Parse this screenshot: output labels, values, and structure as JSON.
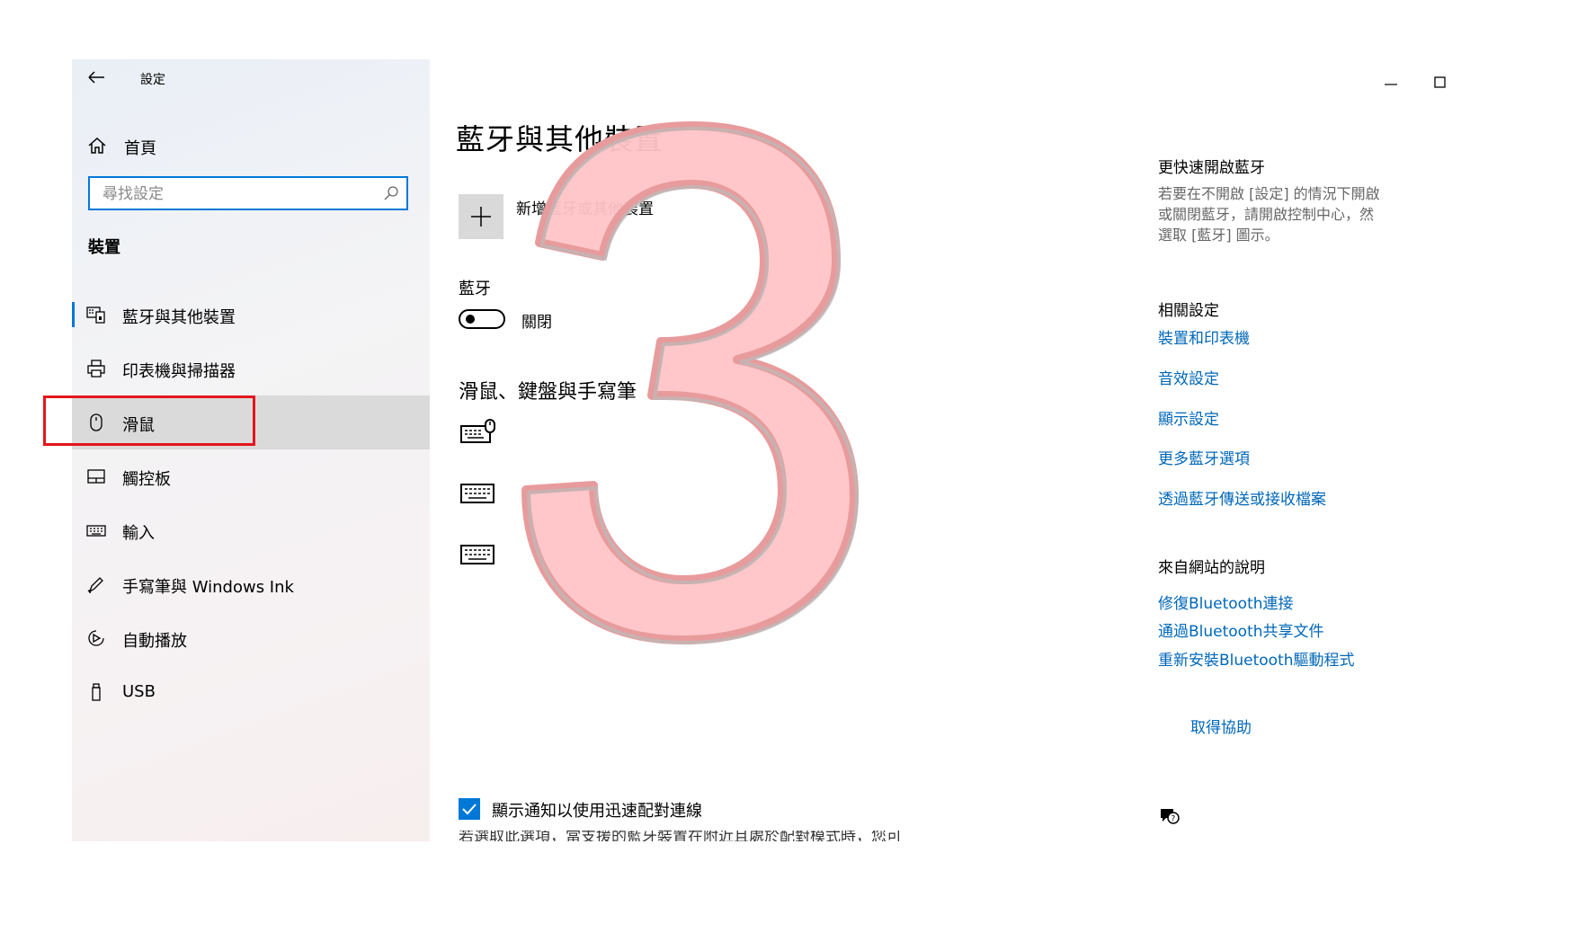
{
  "window": {
    "app_title": "設定"
  },
  "sidebar": {
    "home_label": "首頁",
    "search_placeholder": "尋找設定",
    "section_title": "裝置",
    "items": [
      {
        "label": "藍牙與其他裝置",
        "icon": "bluetooth-devices-icon"
      },
      {
        "label": "印表機與掃描器",
        "icon": "printer-icon"
      },
      {
        "label": "滑鼠",
        "icon": "mouse-icon"
      },
      {
        "label": "觸控板",
        "icon": "touchpad-icon"
      },
      {
        "label": "輸入",
        "icon": "keyboard-icon"
      },
      {
        "label": "手寫筆與 Windows Ink",
        "icon": "pen-icon"
      },
      {
        "label": "自動播放",
        "icon": "autoplay-icon"
      },
      {
        "label": "USB",
        "icon": "usb-icon"
      }
    ]
  },
  "main": {
    "title": "藍牙與其他裝置",
    "add_device_label": "新增藍牙或其他裝置",
    "bluetooth_label": "藍牙",
    "bluetooth_state": "關閉",
    "section_title": "滑鼠、鍵盤與手寫筆",
    "checkbox_label": "顯示通知以使用迅速配對連線",
    "cut_description": "若選取此選項，當支援的藍牙裝置在附近且處於配對模式時，您可"
  },
  "right": {
    "quick_title": "更快速開啟藍牙",
    "quick_desc": [
      "若要在不開啟 [設定] 的情況下開啟",
      "或關閉藍牙，請開啟控制中心，然",
      "選取 [藍牙] 圖示。"
    ],
    "related_title": "相關設定",
    "related_links": [
      "裝置和印表機",
      "音效設定",
      "顯示設定",
      "更多藍牙選項",
      "透過藍牙傳送或接收檔案"
    ],
    "web_title": "來自網站的說明",
    "web_links": [
      "修復Bluetooth連接",
      "通過Bluetooth共享文件",
      "重新安裝Bluetooth驅動程式"
    ],
    "help_label": "取得協助"
  },
  "colors": {
    "accent": "#0078d7",
    "link": "#0067b8",
    "annotation_red": "#e3161c",
    "overlay_fill": "#ffc4c6"
  }
}
